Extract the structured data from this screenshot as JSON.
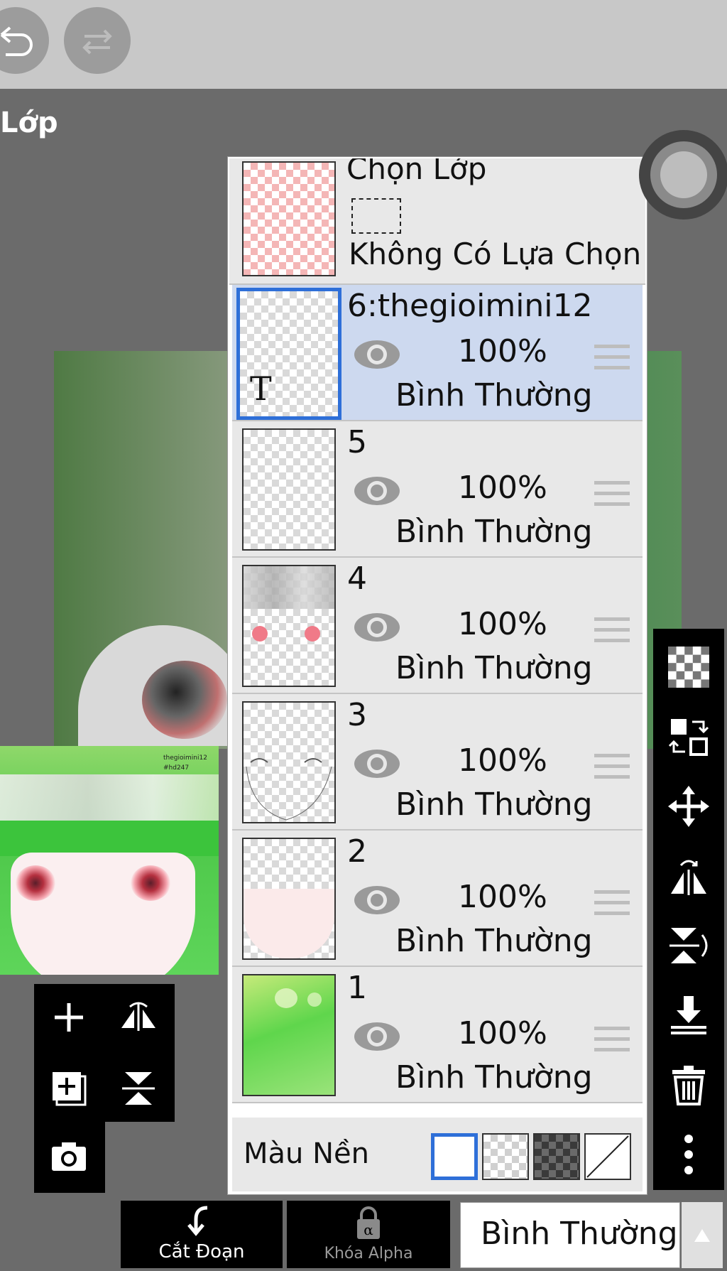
{
  "header": {
    "undo_icon": "undo-icon",
    "redo_icon": "redo-icon"
  },
  "panel": {
    "title": "Lớp"
  },
  "preview": {
    "watermark_1": "thegioimini12",
    "watermark_2": "#hd247"
  },
  "selection": {
    "title": "Chọn Lớp",
    "status": "Không Có Lựa Chọn"
  },
  "layers": [
    {
      "name": "6:thegioimini12",
      "opacity": "100%",
      "mode": "Bình Thường",
      "active": true,
      "text_marker": "T"
    },
    {
      "name": "5",
      "opacity": "100%",
      "mode": "Bình Thường"
    },
    {
      "name": "4",
      "opacity": "100%",
      "mode": "Bình Thường"
    },
    {
      "name": "3",
      "opacity": "100%",
      "mode": "Bình Thường"
    },
    {
      "name": "2",
      "opacity": "100%",
      "mode": "Bình Thường"
    },
    {
      "name": "1",
      "opacity": "100%",
      "mode": "Bình Thường"
    }
  ],
  "background": {
    "label": "Màu Nền"
  },
  "bottom": {
    "clip_label": "Cắt Đoạn",
    "alpha_label": "Khóa Alpha",
    "blend_mode": "Bình Thường"
  },
  "colors": {
    "accent": "#2e6fd8",
    "active_row": "#cdd9ef"
  }
}
